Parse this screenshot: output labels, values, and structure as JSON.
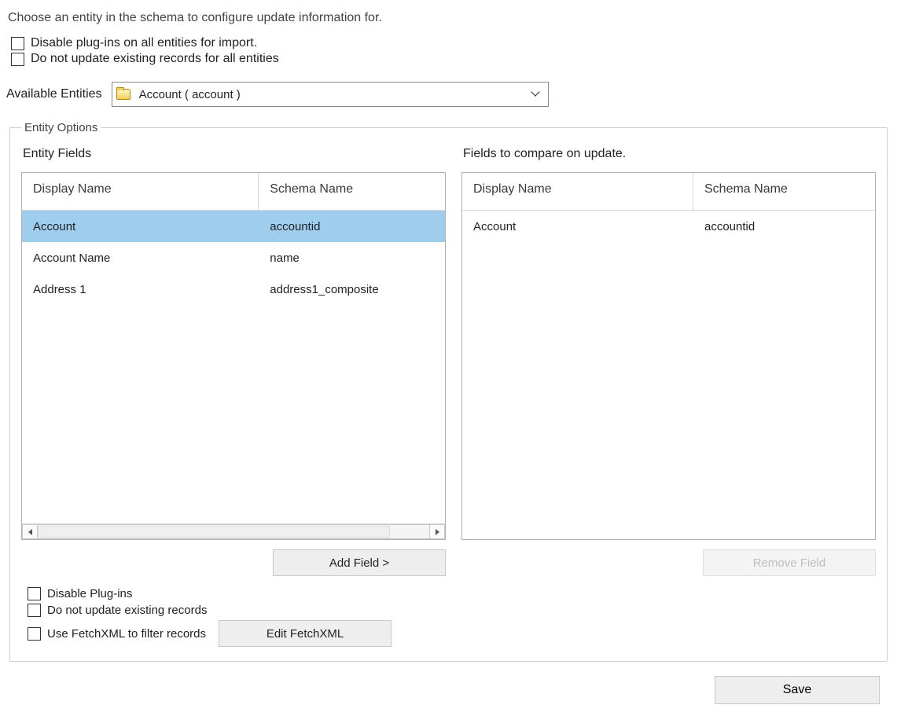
{
  "intro": "Choose an entity in the schema to configure update information for.",
  "global_checks": {
    "disable_plugins": "Disable plug-ins on all entities for import.",
    "do_not_update": "Do not update existing records for all entities"
  },
  "available": {
    "label": "Available Entities",
    "selected": "Account  ( account )"
  },
  "group_legend": "Entity Options",
  "left": {
    "title": "Entity Fields",
    "headers": {
      "display": "Display Name",
      "schema": "Schema Name"
    },
    "rows": [
      {
        "display": "Account",
        "schema": "accountid",
        "selected": true
      },
      {
        "display": "Account Name",
        "schema": "name",
        "selected": false
      },
      {
        "display": "Address 1",
        "schema": "address1_composite",
        "selected": false
      }
    ],
    "add_btn": "Add Field >"
  },
  "right": {
    "title": "Fields to compare on update.",
    "headers": {
      "display": "Display Name",
      "schema": "Schema Name"
    },
    "rows": [
      {
        "display": "Account",
        "schema": "accountid"
      }
    ],
    "remove_btn": "Remove Field"
  },
  "entity_checks": {
    "disable_plugins": "Disable Plug-ins",
    "do_not_update": "Do not update existing records",
    "use_fetchxml": "Use FetchXML to filter records",
    "edit_fx_btn": "Edit FetchXML"
  },
  "save_btn": "Save"
}
